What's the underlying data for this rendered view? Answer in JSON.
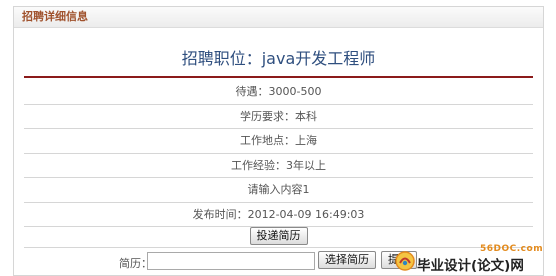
{
  "panel": {
    "header_title": "招聘详细信息"
  },
  "job": {
    "title": "招聘职位：java开发工程师",
    "details": [
      "待遇：3000-500",
      "学历要求：本科",
      "工作地点：上海",
      "工作经验：3年以上",
      "请输入内容1",
      "发布时间：2012-04-09 16:49:03"
    ]
  },
  "actions": {
    "submit_resume_label": "投递简历"
  },
  "upload": {
    "label": "简历：",
    "input_value": "",
    "choose_label": "选择简历",
    "submit_label": "提交"
  },
  "watermark": {
    "url": "56DOC.com",
    "text": "毕业设计(论文)网",
    "accent_color": "#e38b1e"
  }
}
